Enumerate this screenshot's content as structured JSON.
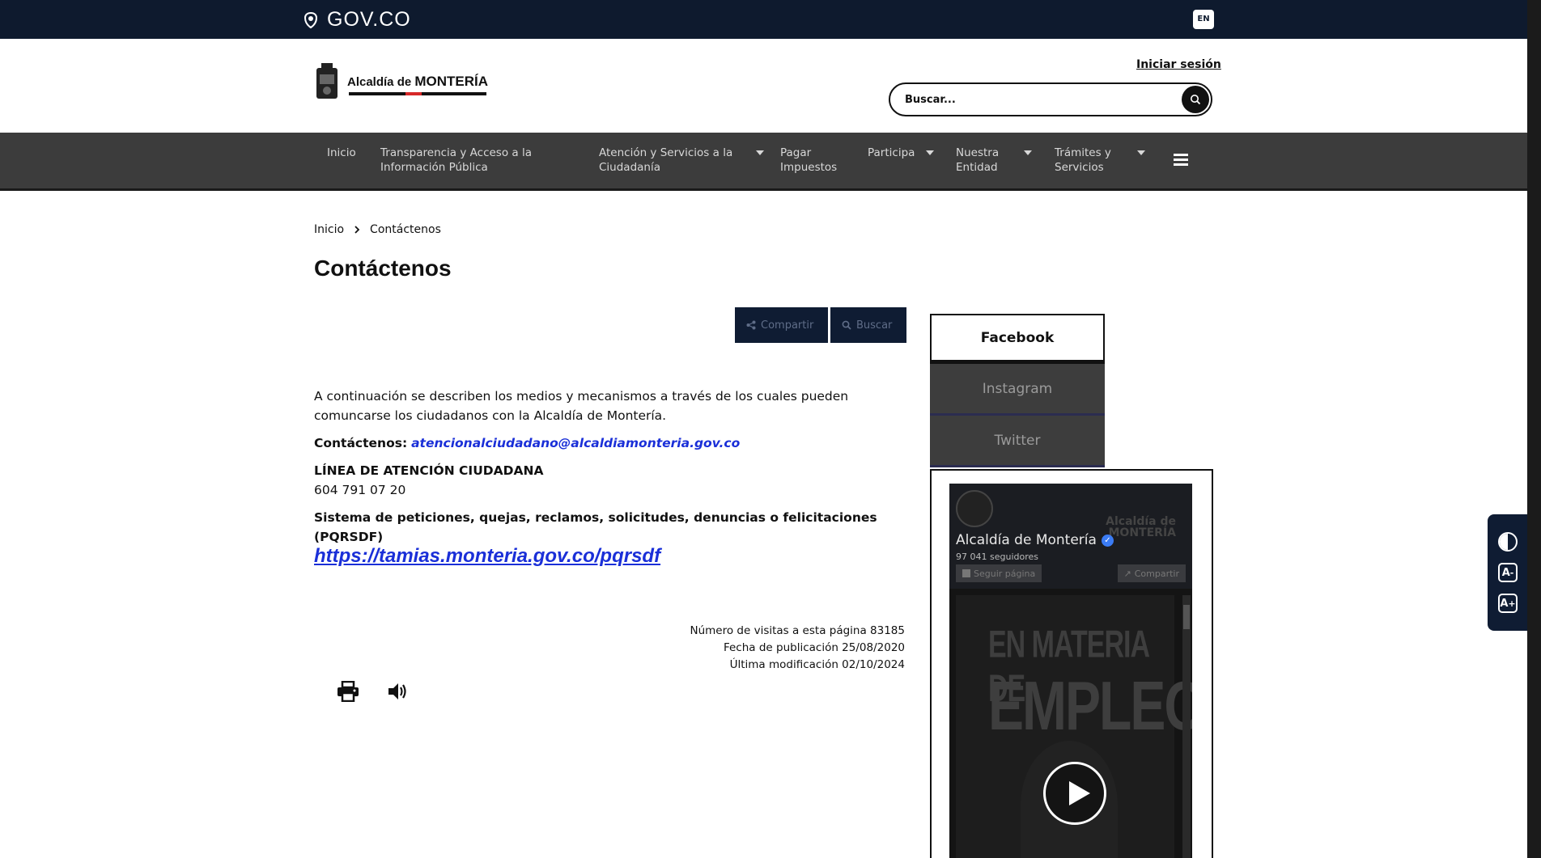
{
  "govbar": {
    "brand": "GOV.CO",
    "lang": "EN"
  },
  "header": {
    "brand_prefix": "Alcaldía de",
    "brand_name": "MONTERÍA",
    "login": "Iniciar sesión",
    "search_placeholder": "Buscar..."
  },
  "nav": {
    "items": [
      {
        "label": "Inicio"
      },
      {
        "label": "Transparencia y Acceso a la Información Pública"
      },
      {
        "label": "Atención y Servicios a la Ciudadanía"
      },
      {
        "label": "Pagar Impuestos"
      },
      {
        "label": "Participa"
      },
      {
        "label": "Nuestra Entidad"
      },
      {
        "label": "Trámites y Servicios"
      }
    ]
  },
  "breadcrumb": {
    "home": "Inicio",
    "current": "Contáctenos"
  },
  "page_title": "Contáctenos",
  "actions": {
    "share": "Compartir",
    "search": "Buscar"
  },
  "content": {
    "intro": "A continuación se describen los medios y mecanismos a través de los cuales pueden comuncarse los ciudadanos con la Alcaldía de Montería.",
    "contact_label": "Contáctenos:",
    "contact_email": "atencionalciudadano@alcaldiamonteria.gov.co",
    "line_title": "LÍNEA DE ATENCIÓN CIUDADANA",
    "line_number": "604 791 07 20",
    "pqrsdf_title": "Sistema de peticiones, quejas, reclamos, solicitudes, denuncias o felicitaciones (PQRSDF)",
    "pqrsdf_link": "https://tamias.monteria.gov.co/pqrsdf"
  },
  "meta": {
    "visits": "Número de visitas a esta página 83185",
    "published": "Fecha de publicación 25/08/2020",
    "modified": "Última modificación 02/10/2024"
  },
  "social": {
    "tabs": [
      "Facebook",
      "Instagram",
      "Twitter"
    ],
    "fb_name": "Alcaldía de Montería",
    "fb_followers": "97 041 seguidores",
    "fb_follow": "Seguir página",
    "fb_share": "Compartir",
    "fb_watermark_1": "Alcaldía de",
    "fb_watermark_2": "MONTERÍA",
    "video_line1": "EN MATERIA DE",
    "video_line2": "EMPLEO"
  },
  "a11y": {
    "smaller": "A",
    "larger": "A"
  }
}
